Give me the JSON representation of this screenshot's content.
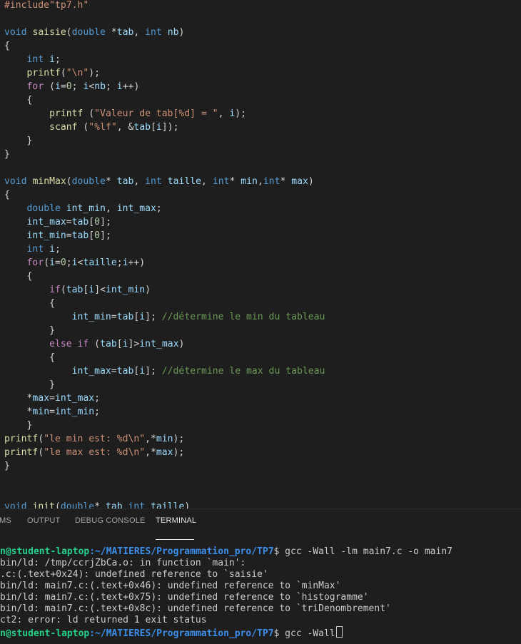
{
  "colors": {
    "background": "#1e1e1e",
    "keyword": "#569cd6",
    "control": "#c586c0",
    "function": "#dcdcaa",
    "variable": "#9cdcfe",
    "string": "#ce9178",
    "number": "#b5cea8",
    "comment": "#6a9955",
    "plain": "#d4d4d4",
    "terminal_text": "#cccccc",
    "prompt_user": "#23d18b",
    "prompt_path": "#3b8eea"
  },
  "code_lines": [
    [
      [
        "#include\"tp7.h\"",
        "string"
      ]
    ],
    [],
    [
      [
        "void",
        "keyword"
      ],
      [
        " ",
        "plain"
      ],
      [
        "saisie",
        "function"
      ],
      [
        "(",
        "plain"
      ],
      [
        "double",
        "keyword"
      ],
      [
        " *",
        "plain"
      ],
      [
        "tab",
        "variable"
      ],
      [
        ", ",
        "plain"
      ],
      [
        "int",
        "keyword"
      ],
      [
        " ",
        "plain"
      ],
      [
        "nb",
        "variable"
      ],
      [
        ")",
        "plain"
      ]
    ],
    [
      [
        "{",
        "plain"
      ]
    ],
    [
      [
        "    ",
        "plain"
      ],
      [
        "int",
        "keyword"
      ],
      [
        " ",
        "plain"
      ],
      [
        "i",
        "variable"
      ],
      [
        ";",
        "plain"
      ]
    ],
    [
      [
        "    ",
        "plain"
      ],
      [
        "printf",
        "function"
      ],
      [
        "(",
        "plain"
      ],
      [
        "\"\\n\"",
        "string"
      ],
      [
        ");",
        "plain"
      ]
    ],
    [
      [
        "    ",
        "plain"
      ],
      [
        "for",
        "control"
      ],
      [
        " (",
        "plain"
      ],
      [
        "i",
        "variable"
      ],
      [
        "=",
        "plain"
      ],
      [
        "0",
        "number"
      ],
      [
        "; ",
        "plain"
      ],
      [
        "i",
        "variable"
      ],
      [
        "<",
        "plain"
      ],
      [
        "nb",
        "variable"
      ],
      [
        "; ",
        "plain"
      ],
      [
        "i",
        "variable"
      ],
      [
        "++)",
        "plain"
      ]
    ],
    [
      [
        "    ",
        "plain"
      ],
      [
        "{",
        "plain"
      ]
    ],
    [
      [
        "        ",
        "plain"
      ],
      [
        "printf",
        "function"
      ],
      [
        " (",
        "plain"
      ],
      [
        "\"Valeur de tab[%d] = \"",
        "string"
      ],
      [
        ", ",
        "plain"
      ],
      [
        "i",
        "variable"
      ],
      [
        ");",
        "plain"
      ]
    ],
    [
      [
        "        ",
        "plain"
      ],
      [
        "scanf",
        "function"
      ],
      [
        " (",
        "plain"
      ],
      [
        "\"%lf\"",
        "string"
      ],
      [
        ", &",
        "plain"
      ],
      [
        "tab",
        "variable"
      ],
      [
        "[",
        "plain"
      ],
      [
        "i",
        "variable"
      ],
      [
        "]);",
        "plain"
      ]
    ],
    [
      [
        "    ",
        "plain"
      ],
      [
        "}",
        "plain"
      ]
    ],
    [
      [
        "}",
        "plain"
      ]
    ],
    [],
    [
      [
        "void",
        "keyword"
      ],
      [
        " ",
        "plain"
      ],
      [
        "minMax",
        "function"
      ],
      [
        "(",
        "plain"
      ],
      [
        "double",
        "keyword"
      ],
      [
        "* ",
        "plain"
      ],
      [
        "tab",
        "variable"
      ],
      [
        ", ",
        "plain"
      ],
      [
        "int",
        "keyword"
      ],
      [
        " ",
        "plain"
      ],
      [
        "taille",
        "variable"
      ],
      [
        ", ",
        "plain"
      ],
      [
        "int",
        "keyword"
      ],
      [
        "* ",
        "plain"
      ],
      [
        "min",
        "variable"
      ],
      [
        ",",
        "plain"
      ],
      [
        "int",
        "keyword"
      ],
      [
        "* ",
        "plain"
      ],
      [
        "max",
        "variable"
      ],
      [
        ")",
        "plain"
      ]
    ],
    [
      [
        "{",
        "plain"
      ]
    ],
    [
      [
        "    ",
        "plain"
      ],
      [
        "double",
        "keyword"
      ],
      [
        " ",
        "plain"
      ],
      [
        "int_min",
        "variable"
      ],
      [
        ", ",
        "plain"
      ],
      [
        "int_max",
        "variable"
      ],
      [
        ";",
        "plain"
      ]
    ],
    [
      [
        "    ",
        "plain"
      ],
      [
        "int_max",
        "variable"
      ],
      [
        "=",
        "plain"
      ],
      [
        "tab",
        "variable"
      ],
      [
        "[",
        "plain"
      ],
      [
        "0",
        "number"
      ],
      [
        "];",
        "plain"
      ]
    ],
    [
      [
        "    ",
        "plain"
      ],
      [
        "int_min",
        "variable"
      ],
      [
        "=",
        "plain"
      ],
      [
        "tab",
        "variable"
      ],
      [
        "[",
        "plain"
      ],
      [
        "0",
        "number"
      ],
      [
        "];",
        "plain"
      ]
    ],
    [
      [
        "    ",
        "plain"
      ],
      [
        "int",
        "keyword"
      ],
      [
        " ",
        "plain"
      ],
      [
        "i",
        "variable"
      ],
      [
        ";",
        "plain"
      ]
    ],
    [
      [
        "    ",
        "plain"
      ],
      [
        "for",
        "control"
      ],
      [
        "(",
        "plain"
      ],
      [
        "i",
        "variable"
      ],
      [
        "=",
        "plain"
      ],
      [
        "0",
        "number"
      ],
      [
        ";",
        "plain"
      ],
      [
        "i",
        "variable"
      ],
      [
        "<",
        "plain"
      ],
      [
        "taille",
        "variable"
      ],
      [
        ";",
        "plain"
      ],
      [
        "i",
        "variable"
      ],
      [
        "++)",
        "plain"
      ]
    ],
    [
      [
        "    ",
        "plain"
      ],
      [
        "{",
        "plain"
      ]
    ],
    [
      [
        "        ",
        "plain"
      ],
      [
        "if",
        "control"
      ],
      [
        "(",
        "plain"
      ],
      [
        "tab",
        "variable"
      ],
      [
        "[",
        "plain"
      ],
      [
        "i",
        "variable"
      ],
      [
        "]<",
        "plain"
      ],
      [
        "int_min",
        "variable"
      ],
      [
        ")",
        "plain"
      ]
    ],
    [
      [
        "        ",
        "plain"
      ],
      [
        "{",
        "plain"
      ]
    ],
    [
      [
        "            ",
        "plain"
      ],
      [
        "int_min",
        "variable"
      ],
      [
        "=",
        "plain"
      ],
      [
        "tab",
        "variable"
      ],
      [
        "[",
        "plain"
      ],
      [
        "i",
        "variable"
      ],
      [
        "]; ",
        "plain"
      ],
      [
        "//détermine le min du tableau",
        "comment"
      ]
    ],
    [
      [
        "        ",
        "plain"
      ],
      [
        "}",
        "plain"
      ]
    ],
    [
      [
        "        ",
        "plain"
      ],
      [
        "else",
        "control"
      ],
      [
        " ",
        "plain"
      ],
      [
        "if",
        "control"
      ],
      [
        " (",
        "plain"
      ],
      [
        "tab",
        "variable"
      ],
      [
        "[",
        "plain"
      ],
      [
        "i",
        "variable"
      ],
      [
        "]>",
        "plain"
      ],
      [
        "int_max",
        "variable"
      ],
      [
        ")",
        "plain"
      ]
    ],
    [
      [
        "        ",
        "plain"
      ],
      [
        "{",
        "plain"
      ]
    ],
    [
      [
        "            ",
        "plain"
      ],
      [
        "int_max",
        "variable"
      ],
      [
        "=",
        "plain"
      ],
      [
        "tab",
        "variable"
      ],
      [
        "[",
        "plain"
      ],
      [
        "i",
        "variable"
      ],
      [
        "]; ",
        "plain"
      ],
      [
        "//détermine le max du tableau",
        "comment"
      ]
    ],
    [
      [
        "        ",
        "plain"
      ],
      [
        "}",
        "plain"
      ]
    ],
    [
      [
        "    *",
        "plain"
      ],
      [
        "max",
        "variable"
      ],
      [
        "=",
        "plain"
      ],
      [
        "int_max",
        "variable"
      ],
      [
        ";",
        "plain"
      ]
    ],
    [
      [
        "    *",
        "plain"
      ],
      [
        "min",
        "variable"
      ],
      [
        "=",
        "plain"
      ],
      [
        "int_min",
        "variable"
      ],
      [
        ";",
        "plain"
      ]
    ],
    [
      [
        "    ",
        "plain"
      ],
      [
        "}",
        "plain"
      ]
    ],
    [
      [
        "printf",
        "function"
      ],
      [
        "(",
        "plain"
      ],
      [
        "\"le min est: %d\\n\"",
        "string"
      ],
      [
        ",*",
        "plain"
      ],
      [
        "min",
        "variable"
      ],
      [
        ");",
        "plain"
      ]
    ],
    [
      [
        "printf",
        "function"
      ],
      [
        "(",
        "plain"
      ],
      [
        "\"le max est: %d\\n\"",
        "string"
      ],
      [
        ",*",
        "plain"
      ],
      [
        "max",
        "variable"
      ],
      [
        ");",
        "plain"
      ]
    ],
    [
      [
        "}",
        "plain"
      ]
    ],
    [],
    [],
    [
      [
        "void",
        "keyword"
      ],
      [
        " ",
        "plain"
      ],
      [
        "init",
        "function"
      ],
      [
        "(",
        "plain"
      ],
      [
        "double",
        "keyword"
      ],
      [
        "* ",
        "plain"
      ],
      [
        "tab",
        "variable"
      ],
      [
        " ",
        "plain"
      ],
      [
        "int",
        "keyword"
      ],
      [
        " ",
        "plain"
      ],
      [
        "taille",
        "variable"
      ],
      [
        ")",
        "plain"
      ]
    ]
  ],
  "panel": {
    "tabs": [
      {
        "label": "MS",
        "active": false
      },
      {
        "label": "OUTPUT",
        "active": false
      },
      {
        "label": "DEBUG CONSOLE",
        "active": false
      },
      {
        "label": "TERMINAL",
        "active": true
      }
    ]
  },
  "terminal": {
    "prompt_user": "n@student-laptop",
    "prompt_path": ":~/MATIERES/Programmation_pro/TP7",
    "command1": "$ gcc -Wall -lm main7.c -o main7",
    "output": [
      "bin/ld: /tmp/ccrjZbCa.o: in function `main':",
      ".c:(.text+0x24): undefined reference to `saisie'",
      "bin/ld: main7.c:(.text+0x46): undefined reference to `minMax'",
      "bin/ld: main7.c:(.text+0x75): undefined reference to `histogramme'",
      "bin/ld: main7.c:(.text+0x8c): undefined reference to `triDenombrement'",
      "ct2: error: ld returned 1 exit status"
    ],
    "command2": "$ gcc -Wall"
  }
}
